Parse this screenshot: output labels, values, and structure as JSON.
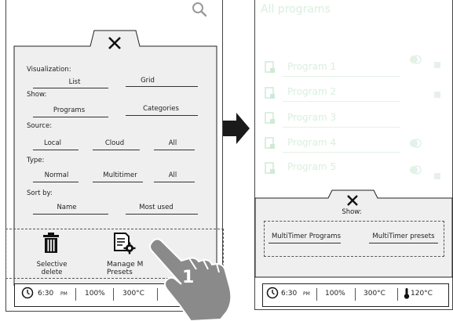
{
  "left_screen": {
    "visualization": {
      "label": "Visualization:",
      "options": [
        "List",
        "Grid"
      ]
    },
    "show": {
      "label": "Show:",
      "options": [
        "Programs",
        "Categories"
      ]
    },
    "source": {
      "label": "Source:",
      "options": [
        "Local",
        "Cloud",
        "All"
      ]
    },
    "type": {
      "label": "Type:",
      "options": [
        "Normal",
        "Multitimer",
        "All"
      ]
    },
    "sort": {
      "label": "Sort by:",
      "options": [
        "Name",
        "Most used"
      ]
    },
    "actions": {
      "selective_delete": [
        "Selective",
        "delete"
      ],
      "manage_presets": [
        "Manage M",
        "Presets"
      ]
    },
    "status": {
      "time": "6:30",
      "ampm": "PM",
      "percent": "100%",
      "temp": "300°C"
    }
  },
  "callout_number": "1",
  "right_screen": {
    "title": "All programs",
    "programs": [
      "Program 1",
      "Program 2",
      "Program 3",
      "Program 4",
      "Program 5"
    ],
    "show_label": "Show:",
    "show_options": [
      "MultiTimer Programs",
      "MultiTimer presets"
    ],
    "status": {
      "time": "6:30",
      "ampm": "PM",
      "percent": "100%",
      "temp": "300°C",
      "probe_temp": "120°C"
    }
  },
  "colors": {
    "panel": "#efefef",
    "faded_green": "#d6eedc",
    "hand": "#8a8a8a",
    "arrow": "#1a1a1a"
  }
}
